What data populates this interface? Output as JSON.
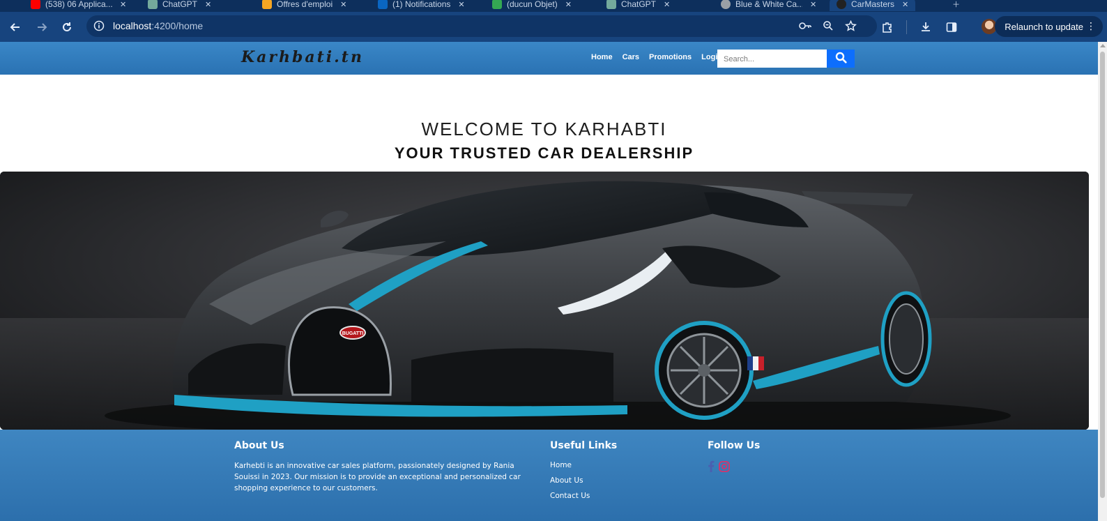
{
  "browser": {
    "tabs": [
      {
        "title": "(538) 06 Applica...",
        "favicon_color": "#ff0000"
      },
      {
        "title": "ChatGPT",
        "favicon_color": "#74aa9c"
      },
      {
        "title": "Offres d'emploi",
        "favicon_color": "#f5a623"
      },
      {
        "title": "(1) Notifications",
        "favicon_color": "#0a66c2"
      },
      {
        "title": "(ducun Objet)",
        "favicon_color": "#34a853"
      },
      {
        "title": "ChatGPT",
        "favicon_color": "#74aa9c"
      },
      {
        "title": "Blue & White Ca...",
        "favicon_color": "#9aa0a6"
      },
      {
        "title": "CarMasters",
        "favicon_color": "#222222"
      }
    ],
    "url_host": "localhost",
    "url_path": ":4200/home",
    "relaunch_label": "Relaunch to update",
    "icons": [
      "back-icon",
      "forward-icon",
      "reload-icon",
      "site-info-icon",
      "password-key-icon",
      "zoom-icon",
      "bookmark-star-icon",
      "extensions-icon",
      "download-icon",
      "side-panel-icon",
      "menu-dots-icon"
    ]
  },
  "navbar": {
    "logo": "Karhbati.tn",
    "links": [
      "Home",
      "Cars",
      "Promotions",
      "Login"
    ],
    "search_placeholder": "Search..."
  },
  "hero": {
    "title": "WELCOME TO KARHABTI",
    "subtitle": "YOUR TRUSTED CAR DEALERSHIP",
    "image_badge": "BUGATTI"
  },
  "footer": {
    "about_title": "About Us",
    "about_text": "Karhebti is an innovative car sales platform, passionately designed by Rania Souissi in 2023. Our mission is to provide an exceptional and personalized car shopping experience to our customers.",
    "links_title": "Useful Links",
    "links": [
      "Home",
      "About Us",
      "Contact Us"
    ],
    "follow_title": "Follow Us",
    "social": [
      "facebook-icon",
      "instagram-icon"
    ]
  },
  "colors": {
    "browser_toolbar": "#17447e",
    "navbar": "#2f7cc0",
    "search_button": "#0d6efd",
    "footer": "#3579b6",
    "car_accent": "#1fa0c4"
  }
}
